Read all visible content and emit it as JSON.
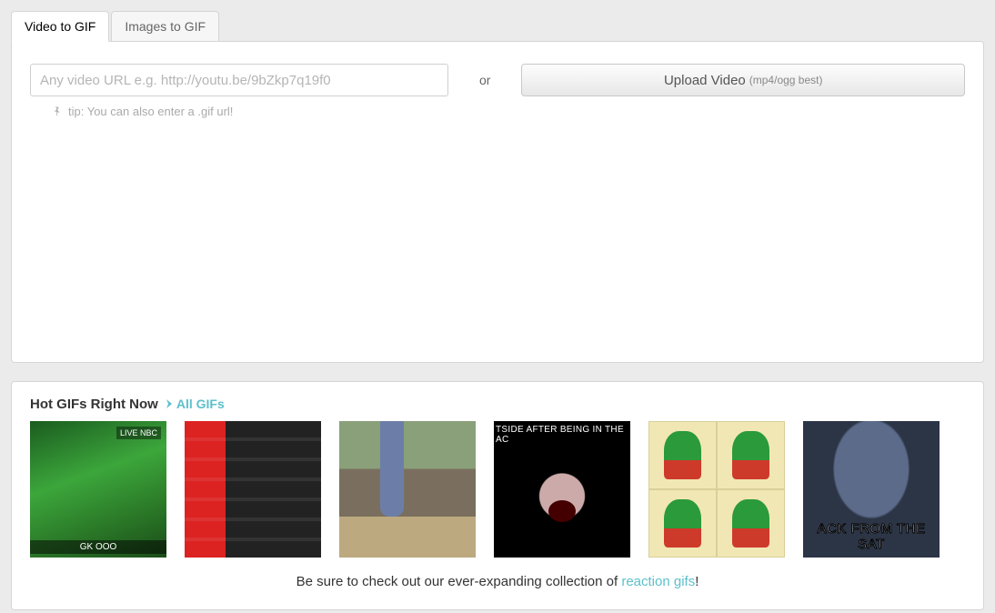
{
  "tabs": {
    "video": "Video to GIF",
    "images": "Images to GIF"
  },
  "input": {
    "url_placeholder": "Any video URL e.g. http://youtu.be/9bZkp7q19f0",
    "or": "or",
    "upload_label": "Upload Video",
    "upload_hint": "(mp4/ogg best)"
  },
  "tip": "tip: You can also enter a .gif url!",
  "hot": {
    "title": "Hot GIFs Right Now",
    "all_link": "All GIFs",
    "cta_pre": "Be sure to check out our ever-expanding collection of ",
    "cta_link": "reaction gifs",
    "cta_post": "!",
    "thumbs": [
      {
        "overlay_top": "LIVE NBC",
        "overlay_bottom": "GK"
      },
      {},
      {},
      {
        "overlay_top": "TSIDE AFTER BEING IN THE AC"
      },
      {},
      {
        "overlay_bottom": "ACK FROM THE SAT"
      }
    ]
  }
}
